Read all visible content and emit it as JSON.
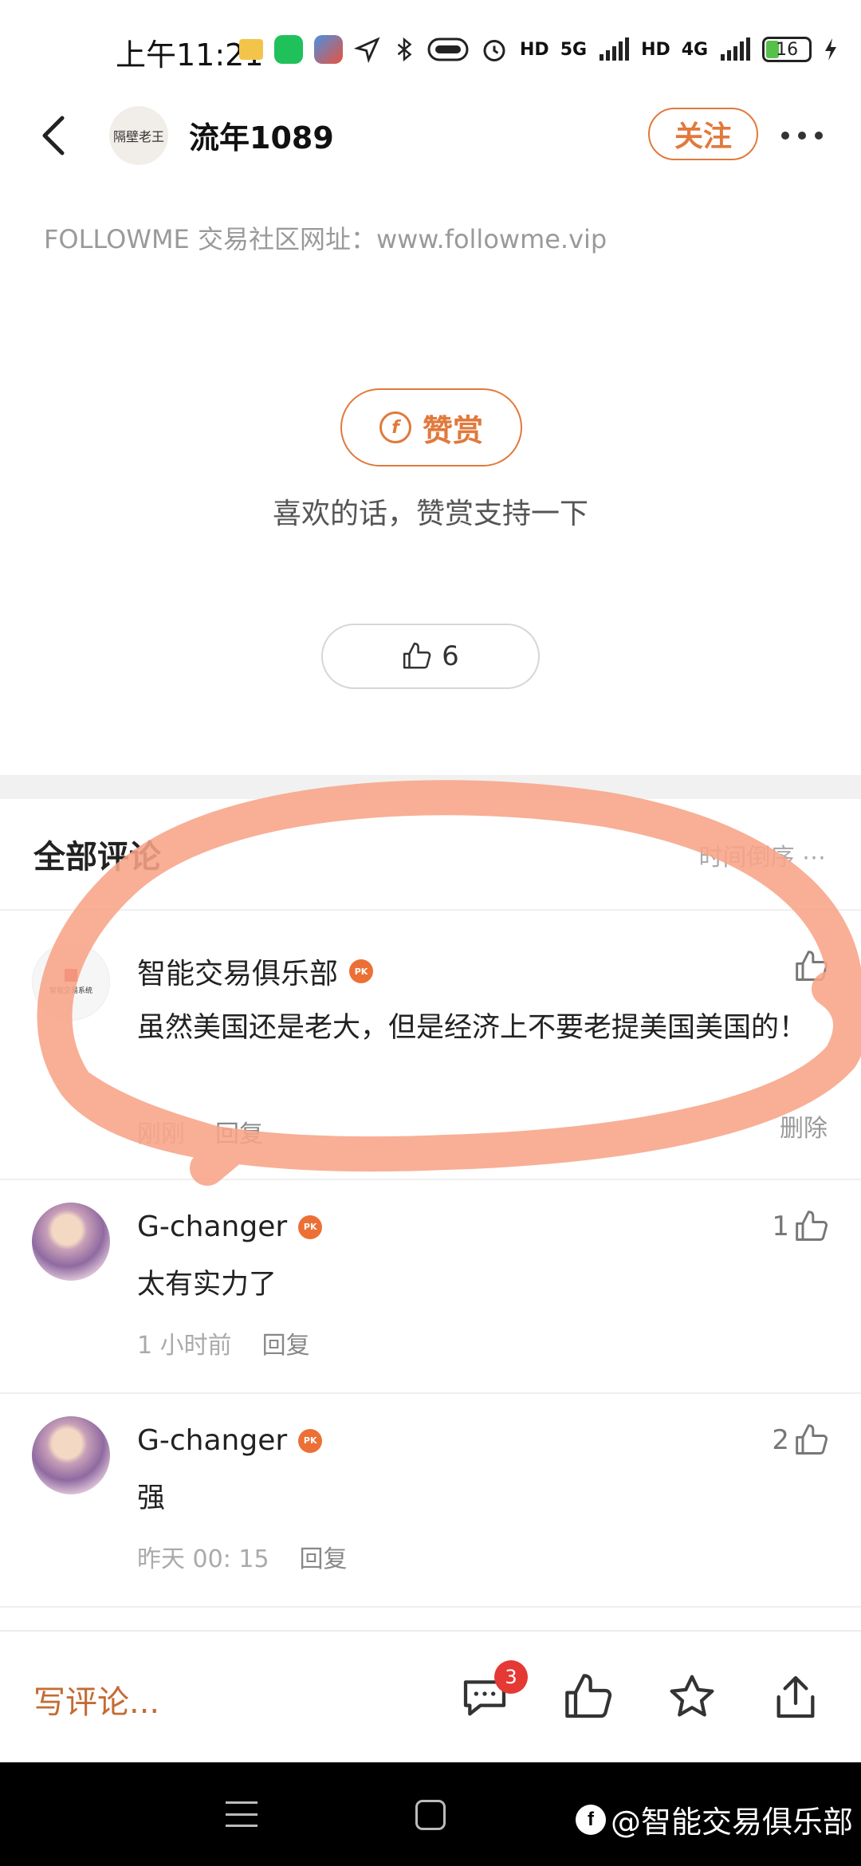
{
  "status_bar": {
    "time": "上午11:21",
    "net_5g": "5G",
    "net_4g": "4G",
    "hd": "HD",
    "battery": "16"
  },
  "header": {
    "avatar_text": "隔壁老王",
    "title": "流年1089",
    "follow_label": "关注"
  },
  "site_note": "FOLLOWME 交易社区网址：www.followme.vip",
  "reward": {
    "button_label": "赞赏",
    "subtitle": "喜欢的话，赞赏支持一下"
  },
  "likes": {
    "count": "6"
  },
  "comments_section": {
    "title": "全部评论",
    "sort_label": "时间倒序 ⋯"
  },
  "comments": [
    {
      "name": "智能交易俱乐部",
      "badge": "PK",
      "text": "虽然美国还是老大，但是经济上不要老提美国美国的！",
      "time": "刚刚",
      "reply": "回复",
      "delete": "删除",
      "likes": ""
    },
    {
      "name": "G-changer",
      "badge": "PK",
      "text": "太有实力了",
      "time": "1 小时前",
      "reply": "回复",
      "likes": "1"
    },
    {
      "name": "G-changer",
      "badge": "PK",
      "text": "强",
      "time": "昨天 00: 15",
      "reply": "回复",
      "likes": "2"
    }
  ],
  "bottom_bar": {
    "write_placeholder": "写评论...",
    "comment_badge": "3"
  },
  "watermark": "@智能交易俱乐部",
  "colors": {
    "accent": "#e1793c",
    "annotation": "#f7a488",
    "badge": "#e53935"
  }
}
